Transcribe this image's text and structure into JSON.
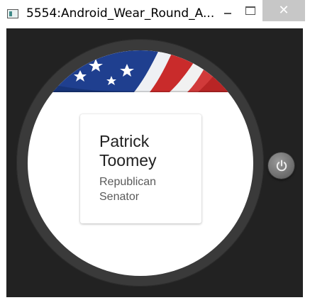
{
  "window": {
    "title": "5554:Android_Wear_Round_A...",
    "minimize_label": "minimize",
    "maximize_label": "maximize",
    "close_glyph": "✕"
  },
  "icons": {
    "app": "emulator-app-icon",
    "power": "power-icon",
    "flag": "us-flag-image"
  },
  "card": {
    "name_line1": "Patrick",
    "name_line2": "Toomey",
    "detail_line1": "Republican",
    "detail_line2": "Senator"
  },
  "colors": {
    "emulator_background": "#222222",
    "bezel": "#3a3a3a",
    "flag_blue": "#1f3f8f",
    "flag_red": "#c92b2b"
  }
}
